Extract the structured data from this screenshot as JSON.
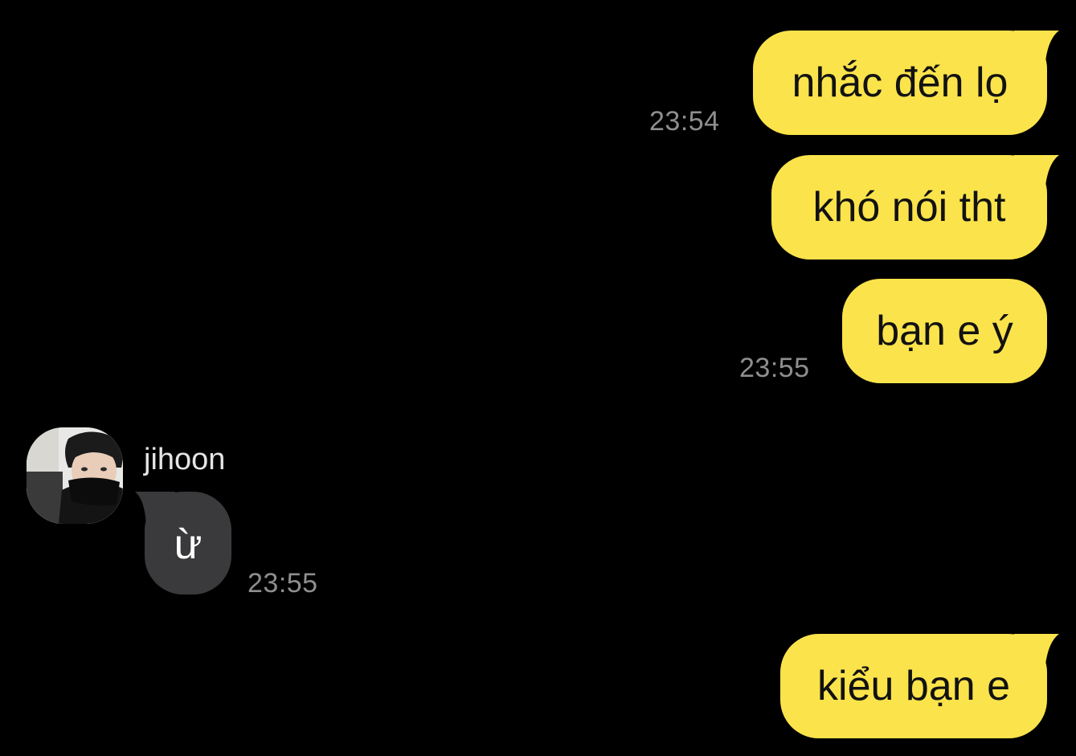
{
  "conversation": {
    "contact": {
      "name": "jihoon",
      "avatar_icon": "profile-photo-avatar"
    },
    "messages": [
      {
        "direction": "outgoing",
        "text": "nhắc đến lọ",
        "time": "23:54"
      },
      {
        "direction": "outgoing",
        "text": "khó nói tht",
        "time": ""
      },
      {
        "direction": "outgoing",
        "text": "bạn e ý",
        "time": "23:55"
      },
      {
        "direction": "incoming",
        "text": "ừ",
        "time": "23:55"
      },
      {
        "direction": "outgoing",
        "text": "kiểu bạn e",
        "time": ""
      }
    ]
  },
  "colors": {
    "background": "#000000",
    "outgoing_bubble": "#fbe34b",
    "outgoing_text": "#121212",
    "incoming_bubble": "#3a3a3c",
    "incoming_text": "#ffffff",
    "timestamp": "#8e8e8e",
    "sender_name": "#e4e4e4"
  }
}
